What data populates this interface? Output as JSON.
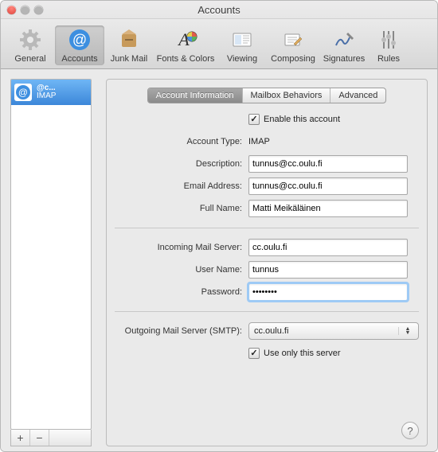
{
  "window": {
    "title": "Accounts"
  },
  "toolbar": {
    "items": [
      {
        "label": "General"
      },
      {
        "label": "Accounts"
      },
      {
        "label": "Junk Mail"
      },
      {
        "label": "Fonts & Colors"
      },
      {
        "label": "Viewing"
      },
      {
        "label": "Composing"
      },
      {
        "label": "Signatures"
      },
      {
        "label": "Rules"
      }
    ]
  },
  "sidebar": {
    "account": {
      "line1": "@c...",
      "line2": "IMAP"
    },
    "add": "+",
    "remove": "−"
  },
  "tabs": {
    "info": "Account Information",
    "mailbox": "Mailbox Behaviors",
    "advanced": "Advanced"
  },
  "form": {
    "enable_label": "Enable this account",
    "account_type_label": "Account Type:",
    "account_type_value": "IMAP",
    "description_label": "Description:",
    "description_value": "tunnus@cc.oulu.fi",
    "email_label": "Email Address:",
    "email_value": "tunnus@cc.oulu.fi",
    "fullname_label": "Full Name:",
    "fullname_value": "Matti Meikäläinen",
    "incoming_label": "Incoming Mail Server:",
    "incoming_value": "cc.oulu.fi",
    "username_label": "User Name:",
    "username_value": "tunnus",
    "password_label": "Password:",
    "password_value": "••••••••",
    "smtp_label": "Outgoing Mail Server (SMTP):",
    "smtp_value": "cc.oulu.fi",
    "use_only_label": "Use only this server"
  },
  "help": "?"
}
